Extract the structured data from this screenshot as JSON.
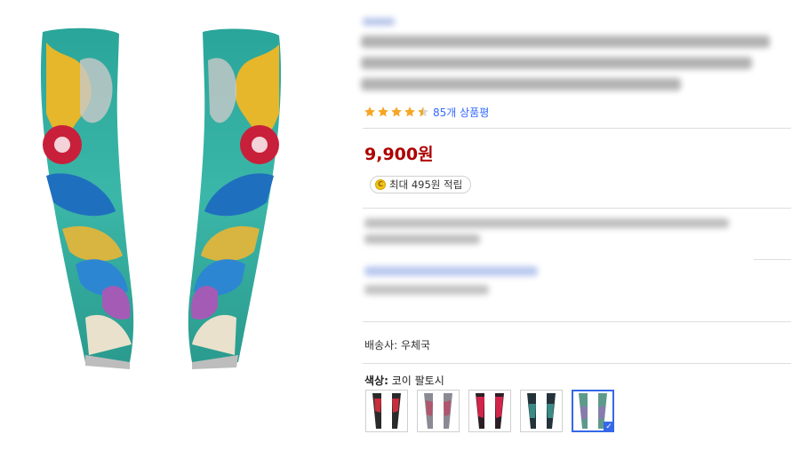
{
  "product": {
    "image_alt": "dragon koi tattoo arm sleeves"
  },
  "rating": {
    "stars": 4.5,
    "review_count_label": "85개 상품평"
  },
  "price": {
    "label": "9,900원",
    "color": "#ae0000"
  },
  "points": {
    "coin_glyph": "C",
    "label": "최대 495원 적립"
  },
  "shipping": {
    "label": "배송사: 우체국"
  },
  "options": {
    "color_label": "색상:",
    "color_value": "코이 팔토시",
    "swatches": [
      {
        "icon": "sleeve-red-black"
      },
      {
        "icon": "sleeve-grey"
      },
      {
        "icon": "sleeve-red"
      },
      {
        "icon": "sleeve-dark-teal"
      },
      {
        "icon": "sleeve-koi",
        "selected": true
      }
    ]
  },
  "colors": {
    "accent": "#3568e8",
    "link": "#346aff",
    "star": "#f5a623"
  }
}
